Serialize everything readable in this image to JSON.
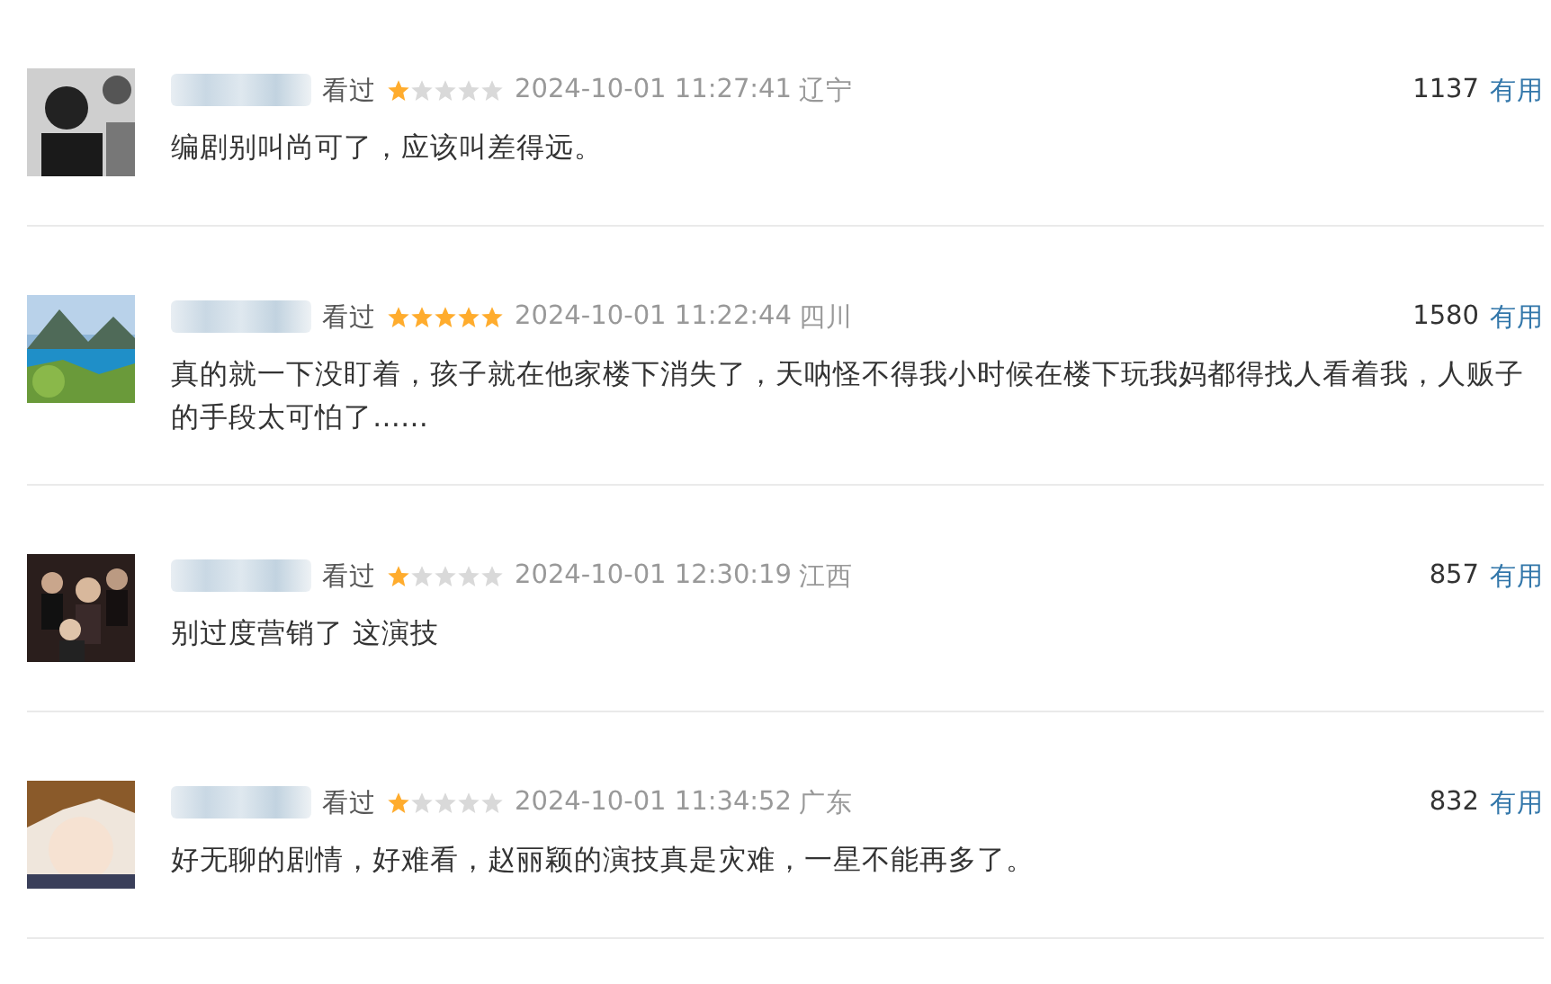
{
  "comments": [
    {
      "status": "看过",
      "stars": 1,
      "time": "2024-10-01 11:27:41",
      "location": "辽宁",
      "votes": "1137",
      "vote_link": "有用",
      "text": "编剧别叫尚可了，应该叫差得远。"
    },
    {
      "status": "看过",
      "stars": 5,
      "time": "2024-10-01 11:22:44",
      "location": "四川",
      "votes": "1580",
      "vote_link": "有用",
      "text": "真的就一下没盯着，孩子就在他家楼下消失了，天呐怪不得我小时候在楼下玩我妈都得找人看着我，人贩子的手段太可怕了……"
    },
    {
      "status": "看过",
      "stars": 1,
      "time": "2024-10-01 12:30:19",
      "location": "江西",
      "votes": "857",
      "vote_link": "有用",
      "text": "别过度营销了 这演技"
    },
    {
      "status": "看过",
      "stars": 1,
      "time": "2024-10-01 11:34:52",
      "location": "广东",
      "votes": "832",
      "vote_link": "有用",
      "text": "好无聊的剧情，好难看，赵丽颖的演技真是灾难，一星不能再多了。"
    }
  ]
}
